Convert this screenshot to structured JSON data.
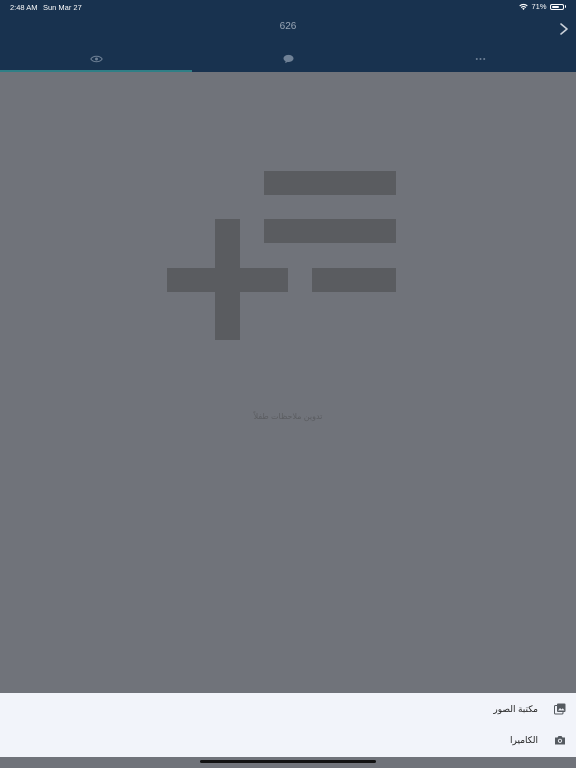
{
  "status_bar": {
    "time": "2:48 AM",
    "date": "Sun Mar 27",
    "battery_percent": "71%",
    "battery_level": 0.71
  },
  "header": {
    "title": "626",
    "next_icon": "chevron-right-icon"
  },
  "tabs": [
    {
      "icon": "eye-icon",
      "active": true
    },
    {
      "icon": "chat-bubble-icon",
      "active": false
    },
    {
      "icon": "more-dots-icon",
      "active": false
    }
  ],
  "empty_state": {
    "icon": "add-list-icon",
    "text": "تدوين ملاحظات طفلاً"
  },
  "action_sheet": {
    "items": [
      {
        "label": "مكتبة الصور",
        "icon": "photo-library-icon"
      },
      {
        "label": "الكاميرا",
        "icon": "camera-icon"
      }
    ]
  },
  "colors": {
    "header_bg": "#18324f",
    "overlay_bg": "#70737a",
    "active_tab_indicator": "#2f7f86",
    "sheet_bg": "#f2f4fa"
  }
}
